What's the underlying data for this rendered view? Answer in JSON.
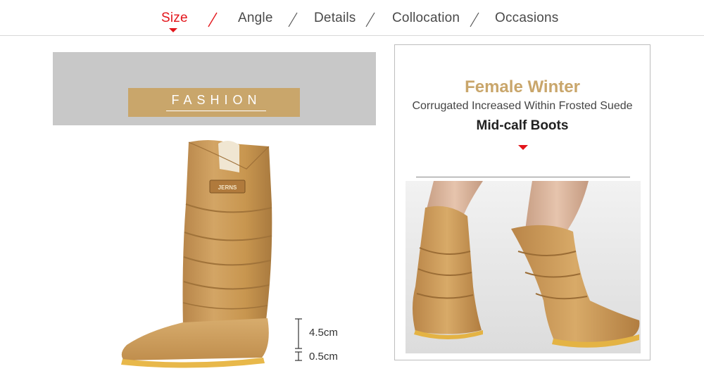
{
  "nav": {
    "items": [
      {
        "label": "Size",
        "active": true
      },
      {
        "label": "Angle",
        "active": false
      },
      {
        "label": "Details",
        "active": false
      },
      {
        "label": "Collocation",
        "active": false
      },
      {
        "label": "Occasions",
        "active": false
      }
    ],
    "active_color": "#e3151b"
  },
  "banner": {
    "label": "FASHION",
    "box_color": "#c9a66b",
    "background": "#c8c8c8"
  },
  "product": {
    "badge": "JERNS",
    "image": "tan-suede-mid-calf-boot"
  },
  "measure": {
    "heel": "4.5cm",
    "platform": "0.5cm"
  },
  "card": {
    "title": "Female Winter",
    "subtitle": "Corrugated Increased Within Frosted Suede",
    "subtitle2": "Mid-calf Boots",
    "title_color": "#c9a66b",
    "photo": "model-wearing-boots"
  }
}
